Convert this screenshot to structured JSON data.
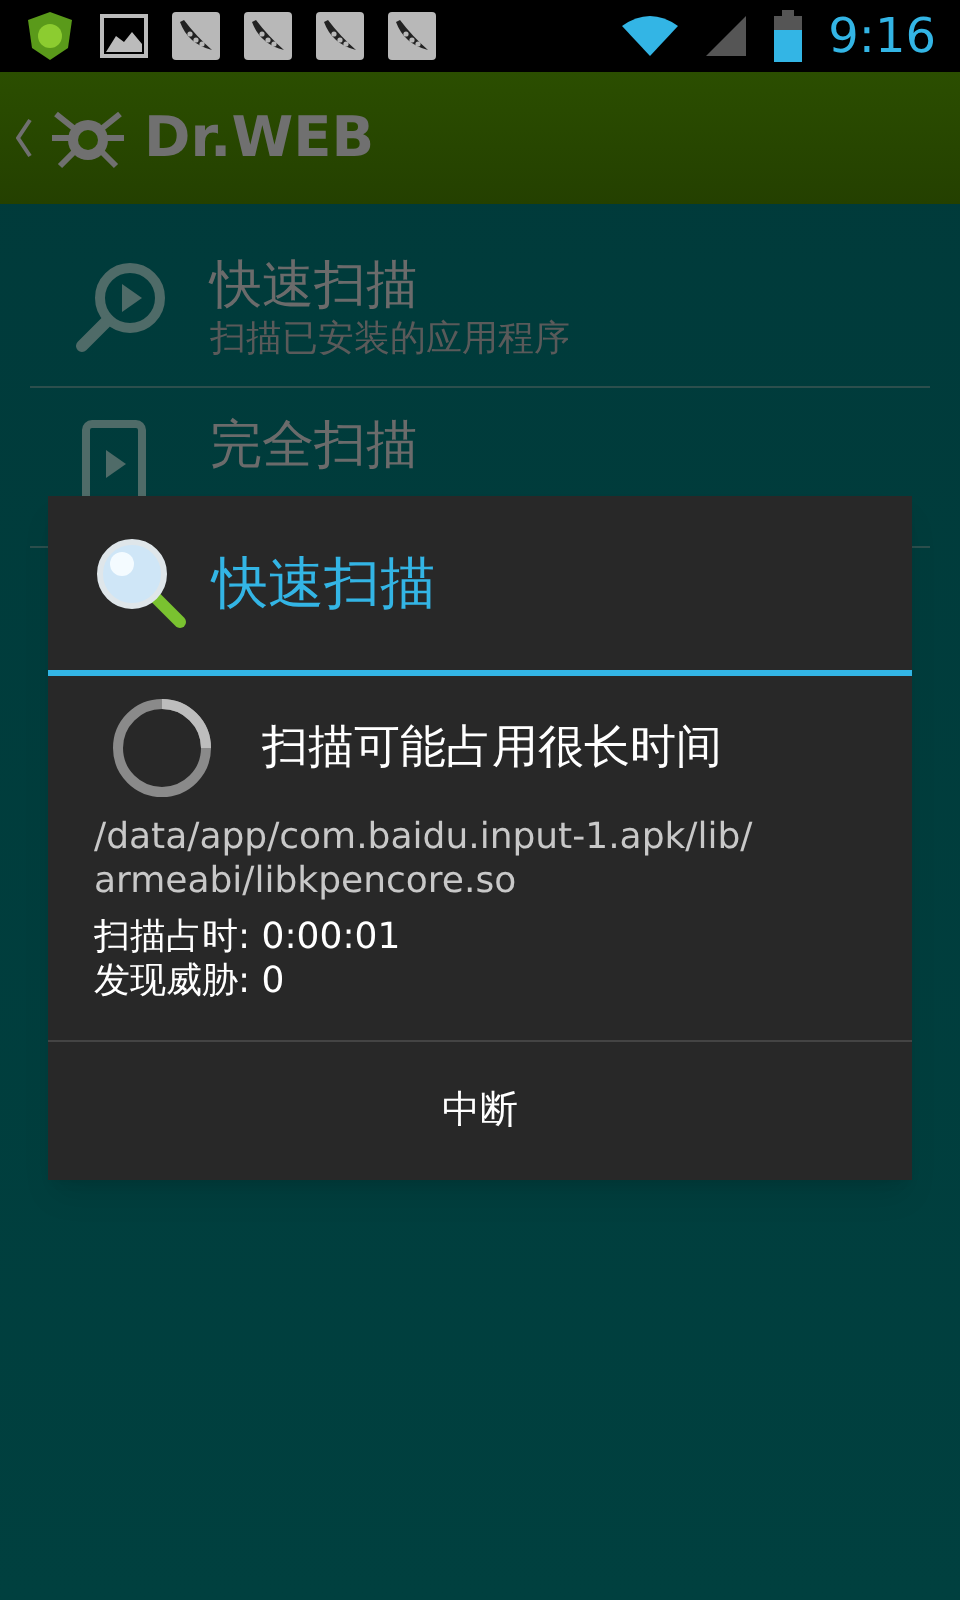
{
  "status_bar": {
    "time": "9:16"
  },
  "action_bar": {
    "title": "Dr.WEB"
  },
  "menu": [
    {
      "kind": "quick",
      "title": "快速扫描",
      "subtitle": "扫描已安装的应用程序"
    },
    {
      "kind": "full",
      "title": "完全扫描"
    }
  ],
  "dialog": {
    "title": "快速扫描",
    "message": "扫描可能占用很长时间",
    "path": "/data/app/com.baidu.input-1.apk/lib/armeabi/libkpencore.so",
    "stats": [
      "扫描占时: 0:00:01",
      "发现威胁: 0"
    ],
    "button": "中断"
  }
}
